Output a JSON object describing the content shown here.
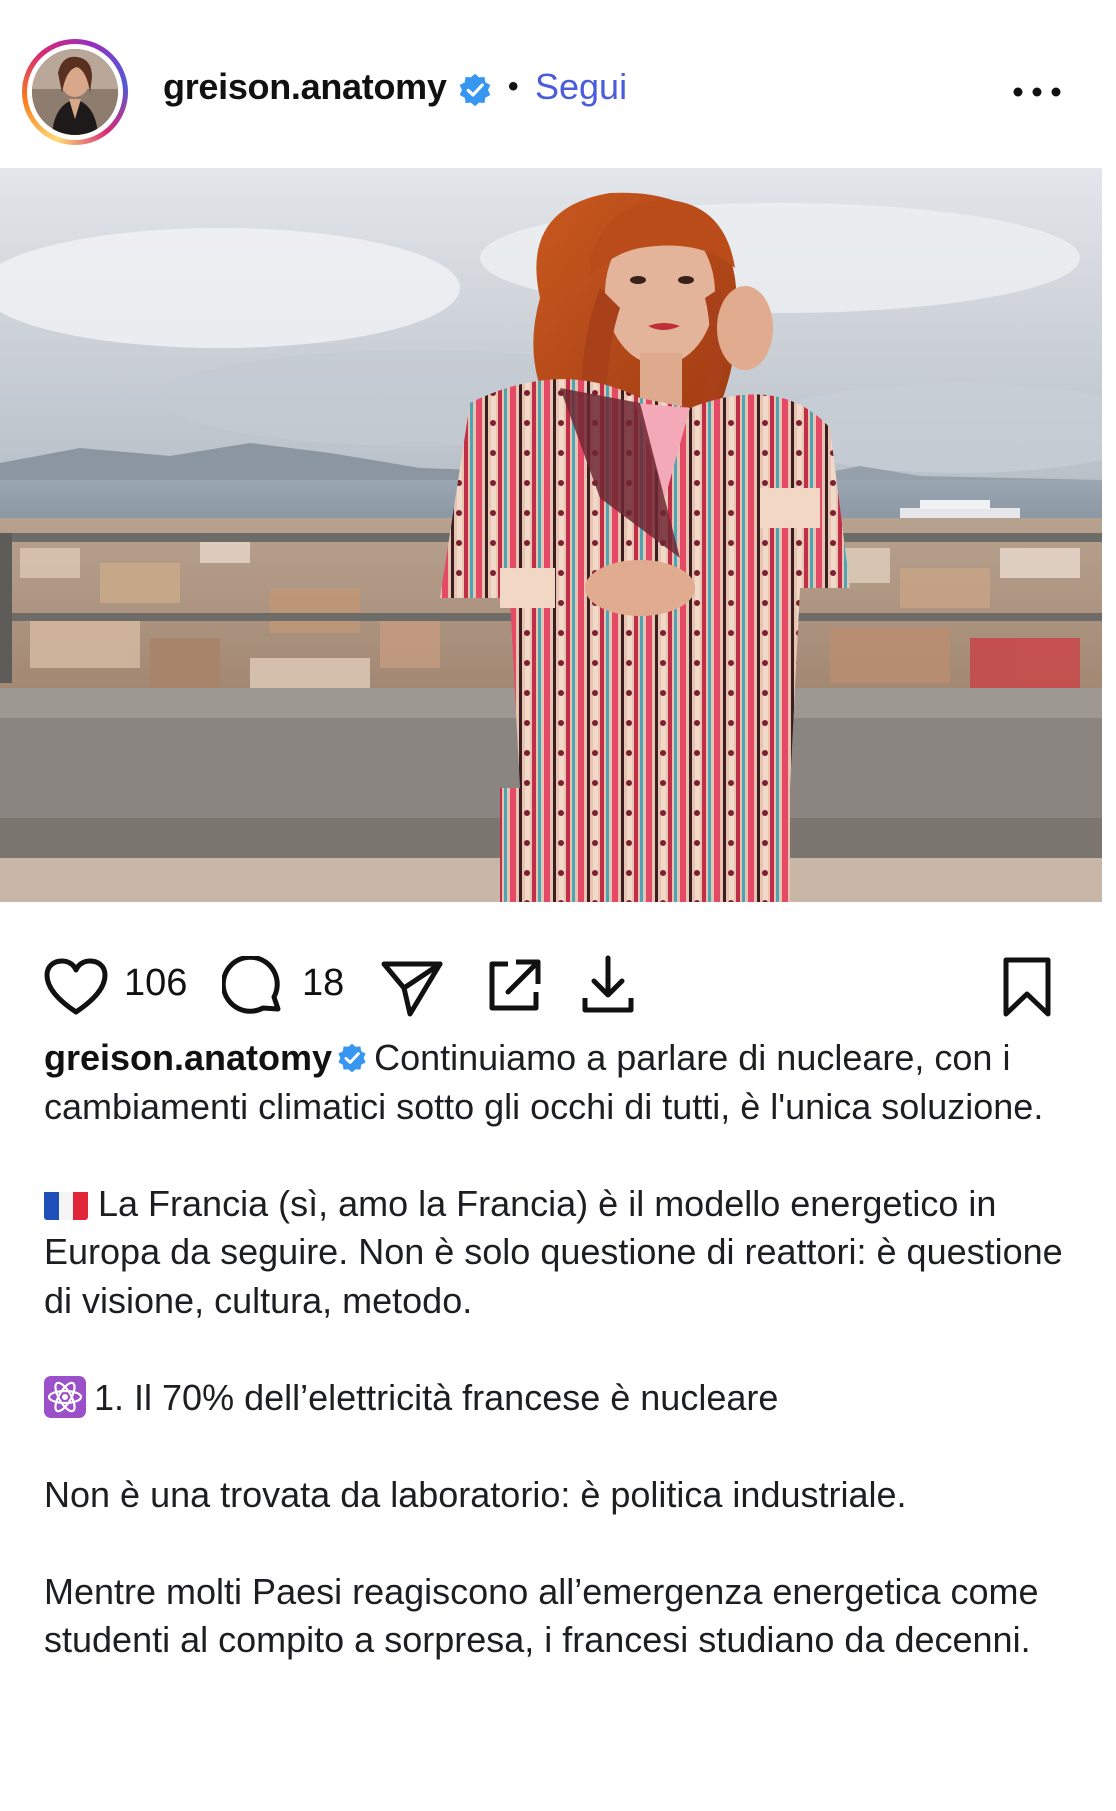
{
  "post": {
    "username": "greison.anatomy",
    "follow_label": "Segui",
    "separator": "•",
    "likes_count": "106",
    "comments_count": "18"
  },
  "icons": {
    "verified": "verified-badge-icon",
    "more": "more-options-icon",
    "like": "heart-icon",
    "comment": "comment-bubble-icon",
    "share": "send-paper-plane-icon",
    "repost": "external-share-icon",
    "download": "download-icon",
    "save": "bookmark-icon",
    "flag": "france-flag-icon",
    "atom": "atom-symbol-icon"
  },
  "colors": {
    "follow_link": "#4a5bdc",
    "verified": "#3797f0"
  },
  "caption": {
    "intro": "Continuiamo a parlare di nucleare, con i cambiamenti climatici sotto gli occhi di tutti, è l'unica soluzione.",
    "france": "La Francia (sì, amo la Francia) è il modello energetico in Europa da seguire. Non è solo questione di reattori: è questione di visione, cultura, metodo.",
    "point1": "1. Il 70% dell’elettricità francese è nucleare",
    "not_lab": "Non è una trovata da laboratorio: è politica industriale.",
    "countries": "Mentre molti Paesi reagiscono all’emergenza energetica come studenti al compito a sorpresa, i francesi studiano da decenni."
  }
}
